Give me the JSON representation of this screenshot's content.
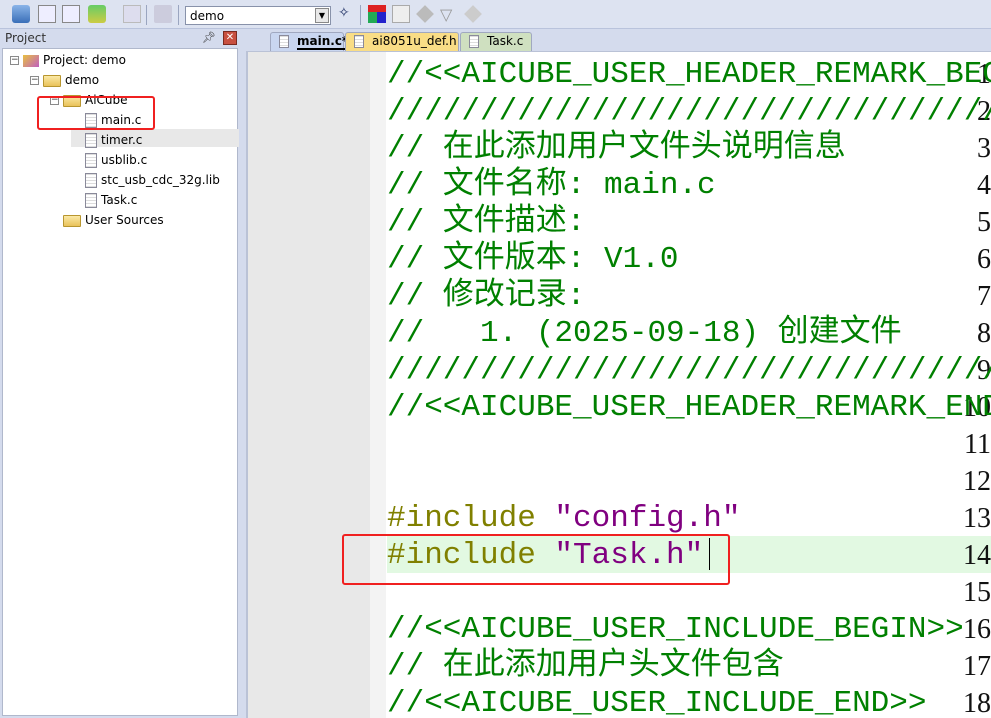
{
  "toolbar": {
    "target": "demo",
    "icons": [
      "translate-icon",
      "build-icon",
      "rebuild-icon",
      "batch-build-icon",
      "stop-build-icon",
      "load-icon",
      "target-options-icon",
      "manage-components-icon",
      "manage-project-items-icon",
      "select-packs-icon",
      "pack-installer-icon",
      "manage-rte-icon"
    ]
  },
  "project_panel": {
    "title": "Project",
    "tree": [
      {
        "label": "Project: demo",
        "level": 0
      },
      {
        "label": "demo",
        "level": 1
      },
      {
        "label": "AiCube",
        "level": 2
      },
      {
        "label": "main.c",
        "level": 3
      },
      {
        "label": "timer.c",
        "level": 3
      },
      {
        "label": "usblib.c",
        "level": 3
      },
      {
        "label": "stc_usb_cdc_32g.lib",
        "level": 3
      },
      {
        "label": "Task.c",
        "level": 3
      },
      {
        "label": "User Sources",
        "level": 2
      }
    ]
  },
  "tabs": [
    {
      "label": "main.c*",
      "active": true
    },
    {
      "label": "ai8051u_def.h"
    },
    {
      "label": "Task.c"
    }
  ],
  "editor": {
    "current_line": 14,
    "lines": [
      {
        "n": "1",
        "t": "//<<AICUBE_USER_HEADER_REMARK_BEGIN>>"
      },
      {
        "n": "2",
        "t": "////////////////////////////////////////"
      },
      {
        "n": "3",
        "t": "// 在此添加用户文件头说明信息"
      },
      {
        "n": "4",
        "t": "// 文件名称: main.c"
      },
      {
        "n": "5",
        "t": "// 文件描述:"
      },
      {
        "n": "6",
        "t": "// 文件版本: V1.0"
      },
      {
        "n": "7",
        "t": "// 修改记录:"
      },
      {
        "n": "8",
        "t": "//   1. (2025-09-18) 创建文件"
      },
      {
        "n": "9",
        "t": "////////////////////////////////////////"
      },
      {
        "n": "10",
        "t": "//<<AICUBE_USER_HEADER_REMARK_END>>"
      },
      {
        "n": "11",
        "t": ""
      },
      {
        "n": "12",
        "t": ""
      },
      {
        "n": "13",
        "kw": "#include",
        "str": " \"config.h\""
      },
      {
        "n": "14",
        "kw": "#include",
        "str": " \"Task.h\""
      },
      {
        "n": "15",
        "t": ""
      },
      {
        "n": "16",
        "t": "//<<AICUBE_USER_INCLUDE_BEGIN>>"
      },
      {
        "n": "17",
        "t": "// 在此添加用户头文件包含"
      },
      {
        "n": "18",
        "t": "//<<AICUBE_USER_INCLUDE_END>>"
      }
    ]
  }
}
